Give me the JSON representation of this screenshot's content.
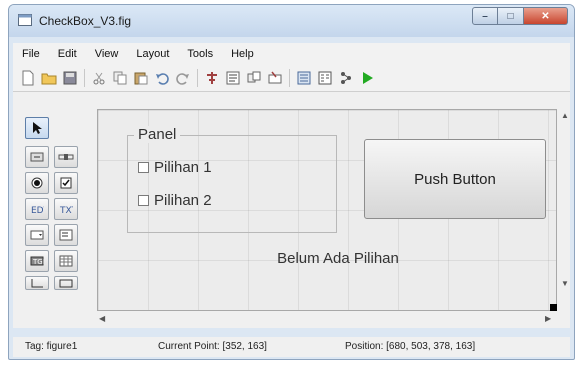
{
  "window": {
    "title": "CheckBox_V3.fig"
  },
  "menu": [
    "File",
    "Edit",
    "View",
    "Layout",
    "Tools",
    "Help"
  ],
  "toolbar_icons": [
    "new-icon",
    "open-icon",
    "save-icon",
    "cut-icon",
    "copy-icon",
    "paste-icon",
    "undo-icon",
    "redo-icon",
    "align-icon",
    "menu-editor-icon",
    "tab-order-icon",
    "toolbar-editor-icon",
    "mfile-editor-icon",
    "property-inspector-icon",
    "object-browser-icon",
    "run-icon"
  ],
  "palette_icons": [
    "select-icon",
    "pushbutton-icon",
    "slider-icon",
    "radiobutton-icon",
    "checkbox-icon",
    "edittext-icon",
    "statictext-icon",
    "popupmenu-icon",
    "listbox-icon",
    "togglebutton-icon",
    "table-icon",
    "axes-icon",
    "panel-icon",
    "buttongroup-icon"
  ],
  "canvas": {
    "panel_title": "Panel",
    "checkbox1": "Pilihan 1",
    "checkbox2": "Pilihan 2",
    "push_button": "Push Button",
    "static_text": "Belum Ada Pilihan"
  },
  "status": {
    "tag": "Tag: figure1",
    "current_point": "Current Point:  [352, 163]",
    "position": "Position: [680, 503, 378, 163]"
  },
  "colors": {
    "run_green": "#22aa22",
    "close_red": "#c8452e"
  }
}
